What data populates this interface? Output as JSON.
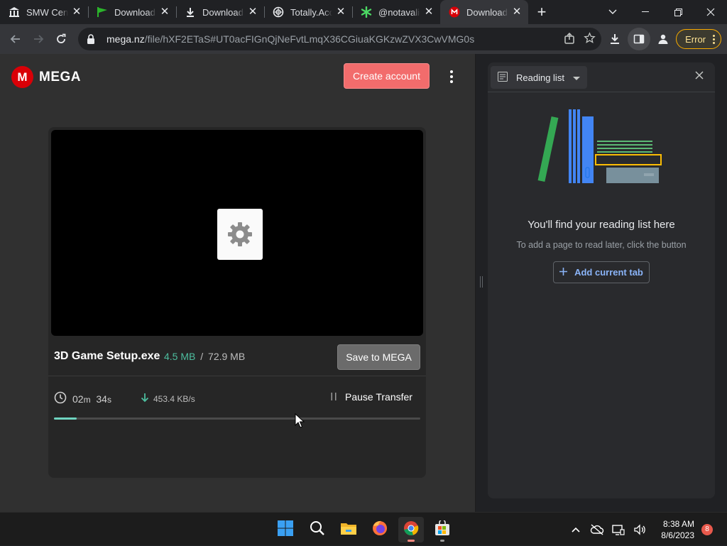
{
  "tabs": [
    {
      "title": "SMW Central",
      "icon": "bank-icon",
      "active": false
    },
    {
      "title": "Download the",
      "icon": "flag-icon",
      "active": false
    },
    {
      "title": "Downloads",
      "icon": "download-icon",
      "active": false
    },
    {
      "title": "Totally.Accu",
      "icon": "globe-icon",
      "active": false
    },
    {
      "title": "@notavalid",
      "icon": "asterisk-icon",
      "active": false
    },
    {
      "title": "Download",
      "icon": "mega-icon",
      "active": true
    }
  ],
  "new_tab": "+",
  "omnibox": {
    "domain": "mega.nz",
    "path": "/file/hXF2ETaS#UT0acFIGnQjNeFvtLmqX36CGiuaKGKzwZVX3CwVMG0s"
  },
  "toolbar": {
    "error_label": "Error"
  },
  "mega": {
    "logo_letter": "M",
    "logo_text": "MEGA",
    "create_account": "Create account",
    "file_name": "3D Game Setup.exe",
    "downloaded": "4.5 MB",
    "size_sep": "/",
    "total_size": "72.9 MB",
    "save_button": "Save to MEGA",
    "time_min": "02",
    "time_min_unit": "m",
    "time_sec": "34",
    "time_sec_unit": "s",
    "speed": "453.4 KB/s",
    "pause_label": "Pause Transfer",
    "progress_pct": 6.2
  },
  "reading_list": {
    "selector_label": "Reading list",
    "empty_title": "You'll find your reading list here",
    "empty_sub": "To add a page to read later, click the button",
    "add_button": "Add current tab"
  },
  "taskbar": {
    "time": "8:38 AM",
    "date": "8/6/2023",
    "notifications": "8"
  },
  "colors": {
    "mega_red": "#d90007",
    "create_button": "#f26c6c",
    "progress": "#6fd4c0",
    "error_outline": "#f9ab00",
    "link_blue": "#8ab4f8"
  }
}
